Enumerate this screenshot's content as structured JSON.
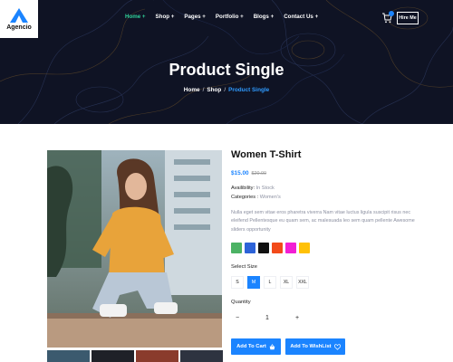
{
  "brand": {
    "name": "Agencio"
  },
  "nav": [
    {
      "label": "Home +",
      "active": true
    },
    {
      "label": "Shop +",
      "active": false
    },
    {
      "label": "Pages +",
      "active": false
    },
    {
      "label": "Portfolio +",
      "active": false
    },
    {
      "label": "Blogs +",
      "active": false
    },
    {
      "label": "Contact Us +",
      "active": false
    }
  ],
  "header": {
    "hire_label": "Hire Me"
  },
  "hero": {
    "title": "Product Single",
    "breadcrumb": [
      "Home",
      "Shop",
      "Product Single"
    ],
    "separator": "/"
  },
  "product": {
    "title": "Women T-Shirt",
    "price": "$15.00",
    "old_price": "$20.00",
    "availability_label": "Availibility:",
    "availability_value": "In Stock",
    "categories_label": "Categories :",
    "categories_value": "Women's",
    "description": "Nulla eget sem vitae eros pharetra viverra Nam vitae luctus ligula suscipit risus nec eleifend Pellentesque eu quam sem, ac malesuada leo sem quam pellente Awesome sliders opportunity",
    "colors": [
      "#4cb264",
      "#2d63d8",
      "#111111",
      "#f24a1a",
      "#f21fd4",
      "#ffc107"
    ],
    "size_label": "Select Size",
    "sizes": [
      "S",
      "M",
      "L",
      "XL",
      "XXL"
    ],
    "selected_size": "M",
    "quantity_label": "Quantity",
    "quantity": "1",
    "qty_minus": "−",
    "qty_plus": "+",
    "add_to_cart": "Add To Cart",
    "add_to_wishlist": "Add To WishList"
  },
  "colors": {
    "accent": "#1b84ff",
    "active_nav": "#2fd39a",
    "hero_bg": "#0f1324"
  }
}
